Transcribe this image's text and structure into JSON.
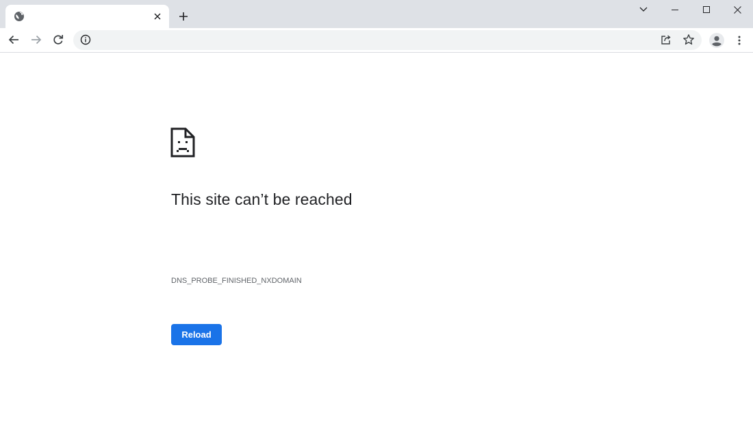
{
  "browser": {
    "tab": {
      "title": "",
      "favicon": "globe-icon"
    },
    "omnibox": {
      "url": "",
      "security_icon": "info-icon"
    },
    "icons": {
      "close_tab": "close-icon",
      "new_tab": "plus-icon",
      "tab_search": "chevron-down-icon",
      "minimize": "minimize-icon",
      "maximize": "maximize-icon",
      "close_window": "close-icon",
      "back": "arrow-left-icon",
      "forward": "arrow-right-icon",
      "reload": "reload-icon",
      "share": "share-icon",
      "bookmark": "star-icon",
      "profile": "profile-icon",
      "menu": "kebab-menu-icon"
    }
  },
  "error_page": {
    "icon": "sad-document-icon",
    "heading": "This site can’t be reached",
    "error_code": "DNS_PROBE_FINISHED_NXDOMAIN",
    "reload_label": "Reload"
  },
  "colors": {
    "tabstrip_bg": "#dee1e6",
    "omnibox_bg": "#f1f3f4",
    "reload_button": "#1a73e8",
    "heading_text": "#202124",
    "secondary_text": "#5f6368"
  }
}
